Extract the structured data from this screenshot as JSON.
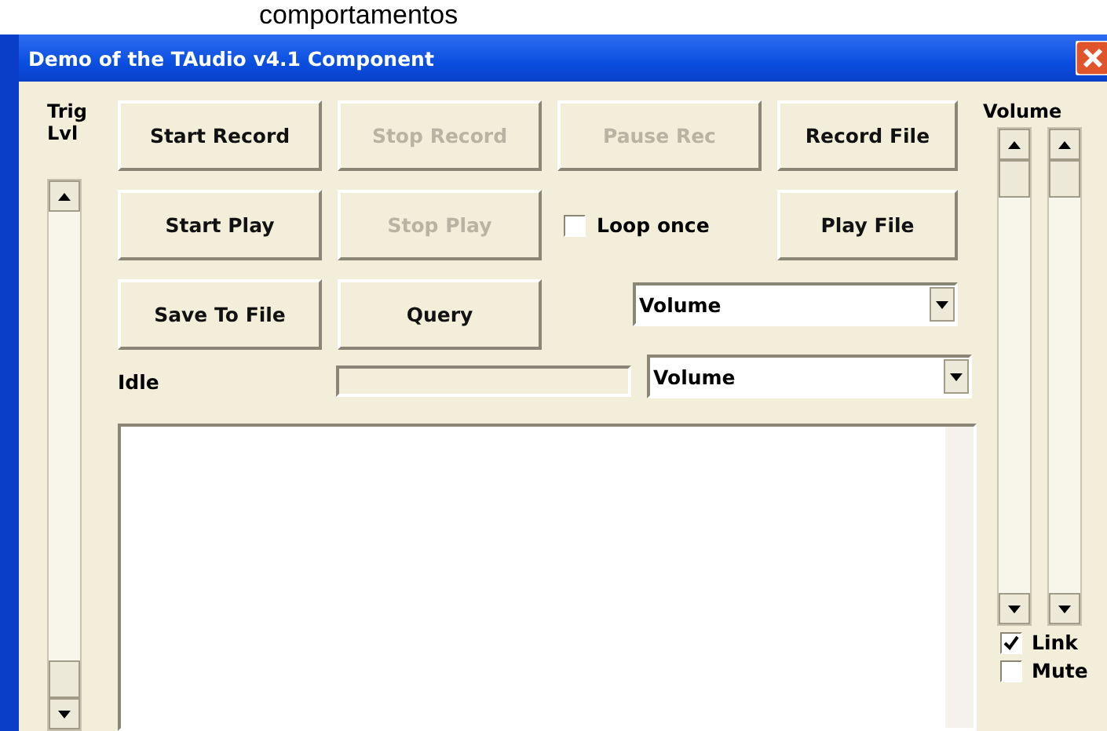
{
  "caption_above": "comportamentos",
  "window": {
    "title": "Demo of the TAudio v4.1 Component"
  },
  "trig_label": "Trig Lvl",
  "buttons": [
    {
      "label": "Start Record",
      "disabled": false
    },
    {
      "label": "Stop Record",
      "disabled": true
    },
    {
      "label": "Pause Rec",
      "disabled": true
    },
    {
      "label": "Record File",
      "disabled": false
    },
    {
      "label": "Start Play",
      "disabled": false
    },
    {
      "label": "Stop Play",
      "disabled": true
    },
    {
      "label": "Play File",
      "disabled": false
    },
    {
      "label": "Save To File",
      "disabled": false
    },
    {
      "label": "Query",
      "disabled": false
    }
  ],
  "loop_checkbox": {
    "label": "Loop once",
    "checked": false
  },
  "combos": [
    {
      "value": "Volume"
    },
    {
      "value": "Volume"
    }
  ],
  "status": "Idle",
  "progress": {
    "level": 0
  },
  "volume_label": "Volume",
  "options": [
    {
      "label": "Link",
      "checked": true
    },
    {
      "label": "Mute",
      "checked": false
    }
  ]
}
